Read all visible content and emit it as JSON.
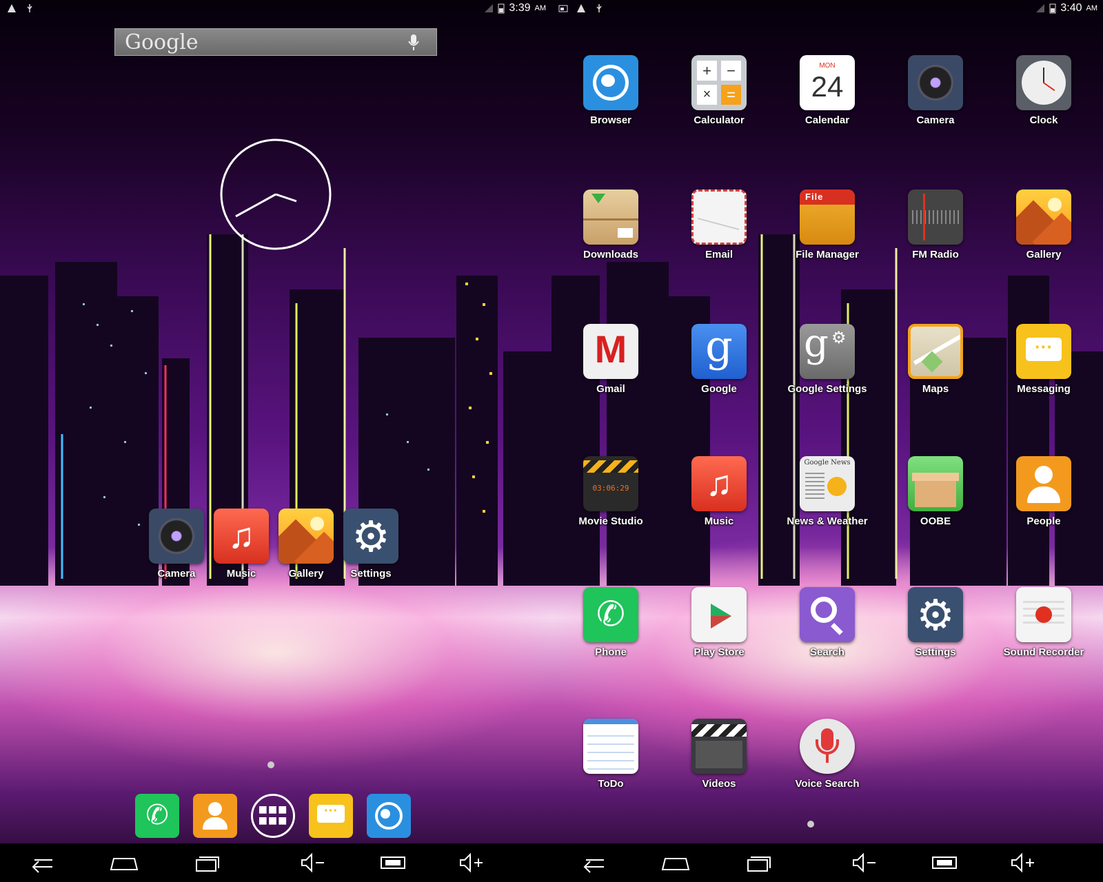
{
  "left": {
    "status": {
      "time": "3:39",
      "ampm": "AM"
    },
    "search": {
      "brand": "Google"
    },
    "home_apps": [
      {
        "label": "Camera",
        "icon": "camera-icon"
      },
      {
        "label": "Music",
        "icon": "music-icon"
      },
      {
        "label": "Gallery",
        "icon": "gallery-icon"
      },
      {
        "label": "Settings",
        "icon": "settings-icon"
      }
    ],
    "dock": [
      "phone-icon",
      "people-icon",
      "all-apps-icon",
      "messaging-icon",
      "browser-icon"
    ]
  },
  "right": {
    "status": {
      "time": "3:40",
      "ampm": "AM"
    },
    "calendar": {
      "day": "MON",
      "date": "24"
    },
    "apps": [
      {
        "label": "Browser",
        "icon": "browser-icon"
      },
      {
        "label": "Calculator",
        "icon": "calculator-icon"
      },
      {
        "label": "Calendar",
        "icon": "calendar-icon"
      },
      {
        "label": "Camera",
        "icon": "camera-icon"
      },
      {
        "label": "Clock",
        "icon": "clock-icon"
      },
      {
        "label": "Downloads",
        "icon": "downloads-icon"
      },
      {
        "label": "Email",
        "icon": "email-icon"
      },
      {
        "label": "File Manager",
        "icon": "file-manager-icon"
      },
      {
        "label": "FM Radio",
        "icon": "fm-radio-icon"
      },
      {
        "label": "Gallery",
        "icon": "gallery-icon"
      },
      {
        "label": "Gmail",
        "icon": "gmail-icon"
      },
      {
        "label": "Google",
        "icon": "google-icon"
      },
      {
        "label": "Google Settings",
        "icon": "google-settings-icon"
      },
      {
        "label": "Maps",
        "icon": "maps-icon"
      },
      {
        "label": "Messaging",
        "icon": "messaging-icon"
      },
      {
        "label": "Movie Studio",
        "icon": "movie-studio-icon"
      },
      {
        "label": "Music",
        "icon": "music-icon"
      },
      {
        "label": "News & Weather",
        "icon": "news-weather-icon"
      },
      {
        "label": "OOBE",
        "icon": "oobe-icon"
      },
      {
        "label": "People",
        "icon": "people-icon"
      },
      {
        "label": "Phone",
        "icon": "phone-icon"
      },
      {
        "label": "Play Store",
        "icon": "play-store-icon"
      },
      {
        "label": "Search",
        "icon": "search-icon"
      },
      {
        "label": "Settings",
        "icon": "settings-icon"
      },
      {
        "label": "Sound Recorder",
        "icon": "sound-recorder-icon"
      },
      {
        "label": "ToDo",
        "icon": "todo-icon"
      },
      {
        "label": "Videos",
        "icon": "videos-icon"
      },
      {
        "label": "Voice Search",
        "icon": "voice-search-icon"
      }
    ]
  },
  "file_manager": {
    "badge": "File"
  },
  "movie_studio": {
    "timecode": "03:06:29"
  },
  "news": {
    "header": "Google News"
  },
  "navbar": [
    "back-icon",
    "home-icon",
    "recents-icon",
    "volume-down-icon",
    "screenshot-icon",
    "volume-up-icon"
  ],
  "colors": {
    "phone": "#1fc45a",
    "people": "#f39a1e",
    "messaging": "#f7c21c",
    "browser": "#2b8fe0"
  }
}
